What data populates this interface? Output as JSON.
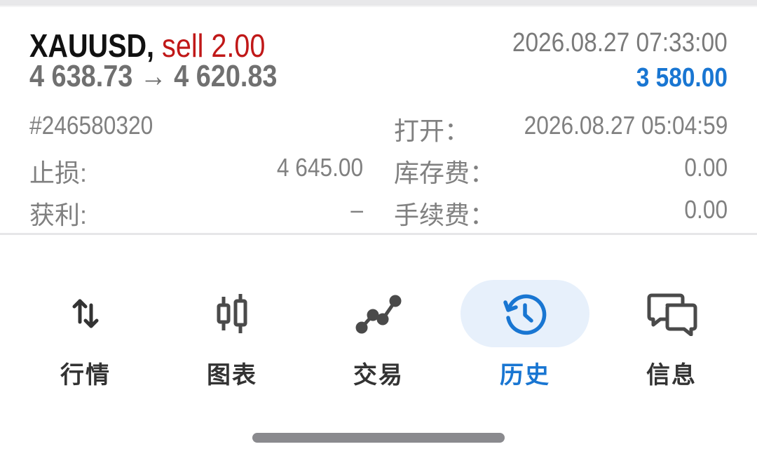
{
  "trade": {
    "symbol": "XAUUSD,",
    "side_volume": "sell 2.00",
    "open_price": "4 638.73",
    "arrow": "→",
    "close_price": "4 620.83",
    "close_time": "2026.08.27 07:33:00",
    "profit": "3 580.00",
    "ticket": "#246580320",
    "open_label": "打开：",
    "open_time": "2026.08.27 05:04:59",
    "sl_label": "止损:",
    "sl_value": "4 645.00",
    "swap_label": "库存费：",
    "swap_value": "0.00",
    "tp_label": "获利:",
    "tp_value": "–",
    "commission_label": "手续费：",
    "commission_value": "0.00"
  },
  "nav": {
    "items": [
      {
        "label": "行情",
        "icon": "quotes-arrows-icon"
      },
      {
        "label": "图表",
        "icon": "candlestick-icon"
      },
      {
        "label": "交易",
        "icon": "trade-line-icon"
      },
      {
        "label": "历史",
        "icon": "history-icon",
        "active": true
      },
      {
        "label": "信息",
        "icon": "messages-icon"
      }
    ]
  },
  "colors": {
    "accent": "#1976d2",
    "sell": "#c01818",
    "active_bg": "#e7f0fb"
  }
}
